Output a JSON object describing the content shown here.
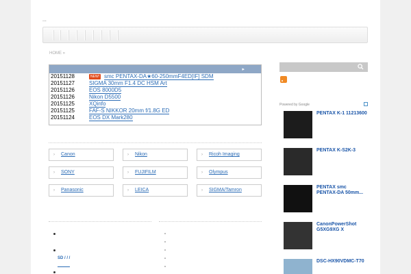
{
  "site": {
    "dots": "..."
  },
  "breadcrumb": {
    "home": "HOME »"
  },
  "news": {
    "arrow": "▸",
    "items": [
      {
        "date": "20151128",
        "badge": "NEW!",
        "title": "smc PENTAX-DA★60-250mmF4ED[IF] SDM"
      },
      {
        "date": "20151127",
        "badge": "",
        "title": " SIGMA 30mm F1.4 DC HSM Art"
      },
      {
        "date": "20151126",
        "badge": "",
        "title": "EOS 8000D5"
      },
      {
        "date": "20151126",
        "badge": "",
        "title": " Nikon D5500"
      },
      {
        "date": "20151125",
        "badge": "",
        "title": "XQinfo"
      },
      {
        "date": "20151125",
        "badge": "",
        "title": " FAF-S NIKKOR 20mm f/1.8G ED"
      },
      {
        "date": "20151124",
        "badge": "",
        "title": "EOS DX Mark280"
      }
    ]
  },
  "categories": [
    {
      "label": "Canon"
    },
    {
      "label": "Nikon"
    },
    {
      "label": "Ricoh Imaging"
    },
    {
      "label": "SONY"
    },
    {
      "label": "FUJIFILM"
    },
    {
      "label": "Olympus"
    },
    {
      "label": "Panasonic"
    },
    {
      "label": "LEICA"
    },
    {
      "label": "SIGMA/Tamron"
    }
  ],
  "chevron": "›",
  "sidebar": {
    "google": "Powered by Google",
    "products": [
      {
        "title": "PENTAX K-1 11213600"
      },
      {
        "title": "PENTAX K-S2K-3"
      },
      {
        "title": "PENTAX smc PENTAX-DA 50mm..."
      },
      {
        "title": "CanonPowerShot G5XG9XG X"
      },
      {
        "title": "DSC-HX90VDMC-T70"
      }
    ]
  },
  "lower": {
    "sd_links": "SD /  /  /"
  },
  "colors": {
    "accent": "#8ea7c6",
    "link": "#2a6bb5",
    "badge": "#e04a1b",
    "rss": "#f08a24"
  }
}
